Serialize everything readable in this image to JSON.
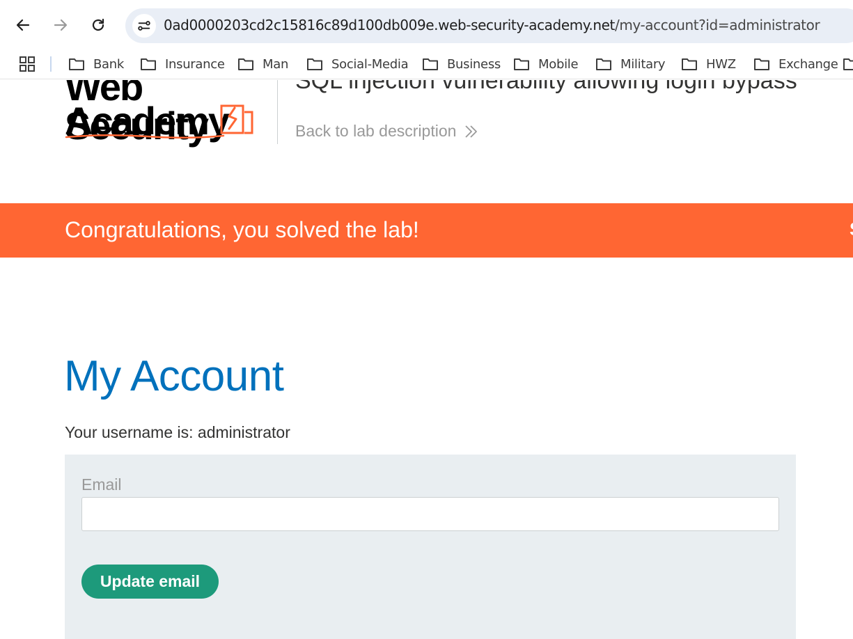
{
  "browser": {
    "url_host": "0ad0000203cd2c15816c89d100db009e.web-security-academy.net",
    "url_path": "/my-account?id=administrator",
    "bookmarks": [
      "Bank",
      "Insurance",
      "Man",
      "Social-Media",
      "Business",
      "Mobile",
      "Military",
      "HWZ",
      "Exchange"
    ]
  },
  "header": {
    "logo_line1": "Web Security",
    "logo_line2": "Academy",
    "lab_title": "SQL injection vulnerability allowing login bypass",
    "back_link": "Back to lab description"
  },
  "banner": {
    "message": "Congratulations, you solved the lab!",
    "cut_text": "S"
  },
  "main": {
    "heading": "My Account",
    "username_text": "Your username is: administrator",
    "email_label": "Email",
    "email_value": "",
    "update_button": "Update email"
  },
  "colors": {
    "accent": "#ff6633",
    "heading": "#0071bc",
    "button": "#1d9a7b"
  }
}
